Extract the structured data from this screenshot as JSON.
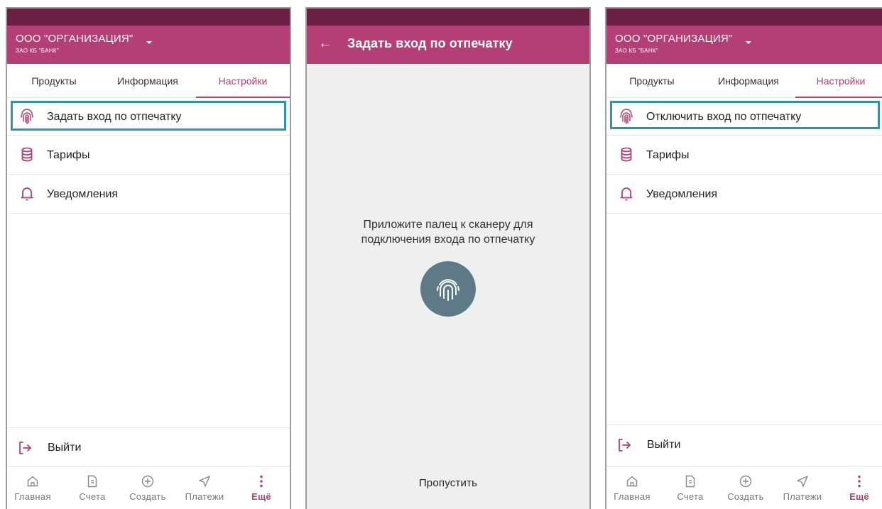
{
  "colors": {
    "accent": "#b43f75",
    "status_bar": "#6b1f45",
    "highlight": "#2f95a5",
    "fingerprint_circle": "#5e7a86"
  },
  "screen_settings_before": {
    "org_name": "ООО \"ОРГАНИЗАЦИЯ\"",
    "bank_name": "ЗАО КБ \"БАНК\"",
    "tabs": [
      "Продукты",
      "Информация",
      "Настройки"
    ],
    "active_tab": "Настройки",
    "menu": [
      {
        "label": "Задать вход по отпечатку",
        "icon": "fingerprint-icon",
        "highlighted": true
      },
      {
        "label": "Тарифы",
        "icon": "database-icon"
      },
      {
        "label": "Уведомления",
        "icon": "bell-icon"
      }
    ],
    "logout_label": "Выйти",
    "nav": [
      "Главная",
      "Счета",
      "Создать",
      "Платежи",
      "Ещё"
    ],
    "active_nav": "Ещё"
  },
  "screen_fingerprint": {
    "title": "Задать вход по отпечатку",
    "prompt_line1": "Приложите палец к сканеру для",
    "prompt_line2": "подключения входа по отпечатку",
    "skip_label": "Пропустить"
  },
  "screen_settings_after": {
    "org_name": "ООО \"ОРГАНИЗАЦИЯ\"",
    "bank_name": "ЗАО КБ \"БАНК\"",
    "tabs": [
      "Продукты",
      "Информация",
      "Настройки"
    ],
    "active_tab": "Настройки",
    "menu": [
      {
        "label": "Отключить вход по отпечатку",
        "icon": "fingerprint-icon",
        "highlighted": true
      },
      {
        "label": "Тарифы",
        "icon": "database-icon"
      },
      {
        "label": "Уведомления",
        "icon": "bell-icon"
      }
    ],
    "logout_label": "Выйти",
    "nav": [
      "Главная",
      "Счета",
      "Создать",
      "Платежи",
      "Ещё"
    ],
    "active_nav": "Ещё"
  }
}
